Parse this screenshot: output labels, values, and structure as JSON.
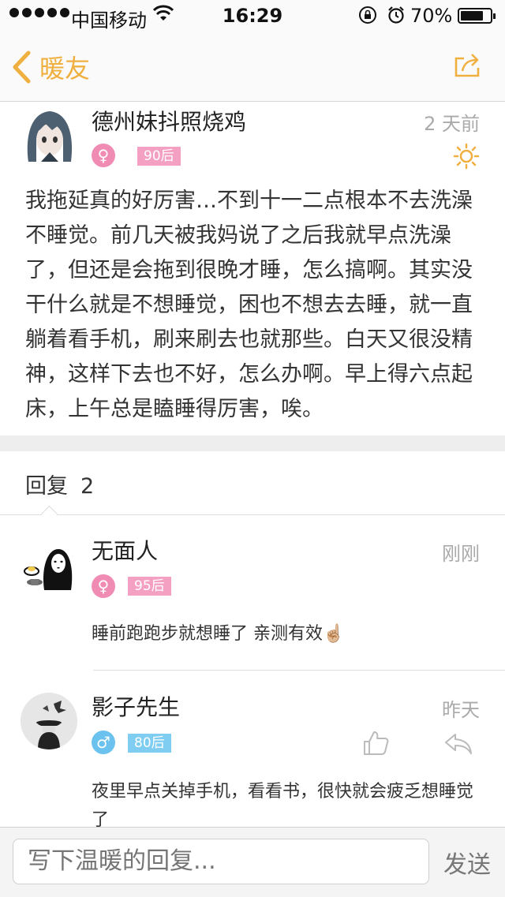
{
  "status_bar": {
    "carrier": "中国移动",
    "time": "16:29",
    "battery": "70%",
    "battery_level": 0.7
  },
  "nav": {
    "back_label": "暖友",
    "icons": {
      "back": "chevron-left-icon",
      "share": "share-icon"
    },
    "accent_color": "#f0b040"
  },
  "post": {
    "author": "德州妹抖照烧鸡",
    "time": "2 天前",
    "gender": "♀",
    "age_tag": "90后",
    "mood_icon": "sun-icon",
    "body": "我拖延真的好厉害…不到十一二点根本不去洗澡不睡觉。前几天被我妈说了之后我就早点洗澡了，但还是会拖到很晚才睡，怎么搞啊。其实没干什么就是不想睡觉，困也不想去去睡，就一直躺着看手机，刷来刷去也就那些。白天又很没精神，这样下去也不好，怎么办啊。早上得六点起床，上午总是瞌睡得厉害，唉。"
  },
  "replies_header": {
    "label": "回复",
    "count": "2"
  },
  "replies": [
    {
      "author": "无面人",
      "time": "刚刚",
      "gender": "♀",
      "age_tag": "95后",
      "text": "睡前跑跑步就想睡了 亲测有效☝🏼"
    },
    {
      "author": "影子先生",
      "time": "昨天",
      "gender": "♂",
      "age_tag": "80后",
      "text": "夜里早点关掉手机，看看书，很快就会疲乏想睡觉了",
      "icons": {
        "like": "thumbs-up-icon",
        "reply": "reply-arrow-icon"
      }
    }
  ],
  "composer": {
    "placeholder": "写下温暖的回复...",
    "send_label": "发送"
  },
  "colors": {
    "female": "#f08cb4",
    "male": "#6cc2ee",
    "divider_band": "#eeeeee"
  }
}
